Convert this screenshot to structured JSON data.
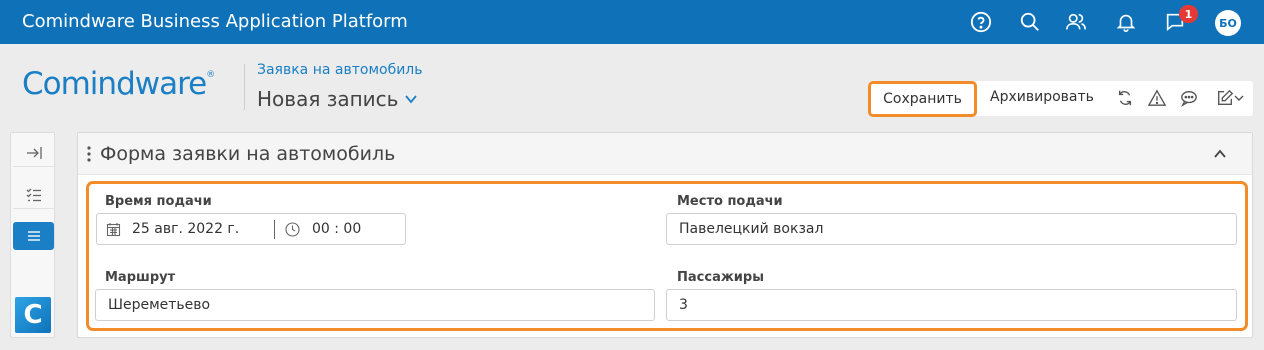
{
  "topbar": {
    "app_title": "Comindware Business Application Platform",
    "notification_count": "1",
    "avatar_initials": "БО",
    "icons": [
      "help-icon",
      "search-icon",
      "users-icon",
      "bell-icon",
      "messages-icon"
    ]
  },
  "header": {
    "logo_text": "Comindware",
    "logo_mark": "®",
    "breadcrumb": "Заявка на автомобиль",
    "record_title": "Новая запись"
  },
  "toolbar": {
    "save_label": "Сохранить",
    "archive_label": "Архивировать",
    "icons": [
      "refresh-icon",
      "warning-icon",
      "comment-icon",
      "edit-icon"
    ]
  },
  "rail": {
    "logo_letter": "C",
    "icons": [
      "expand-panel-icon",
      "checklist-icon",
      "list-icon"
    ]
  },
  "form": {
    "title": "Форма заявки на автомобиль",
    "fields": {
      "pickup_time": {
        "label": "Время подачи",
        "date": "25 авг. 2022 г.",
        "time": "00 : 00"
      },
      "pickup_place": {
        "label": "Место подачи",
        "value": "Павелецкий вокзал"
      },
      "route": {
        "label": "Маршрут",
        "value": "Шереметьево"
      },
      "passengers": {
        "label": "Пассажиры",
        "value": "3"
      }
    }
  },
  "colors": {
    "topbar": "#0f72b9",
    "accent": "#1a7fc4",
    "highlight": "#f28c28",
    "badge": "#e53935"
  }
}
